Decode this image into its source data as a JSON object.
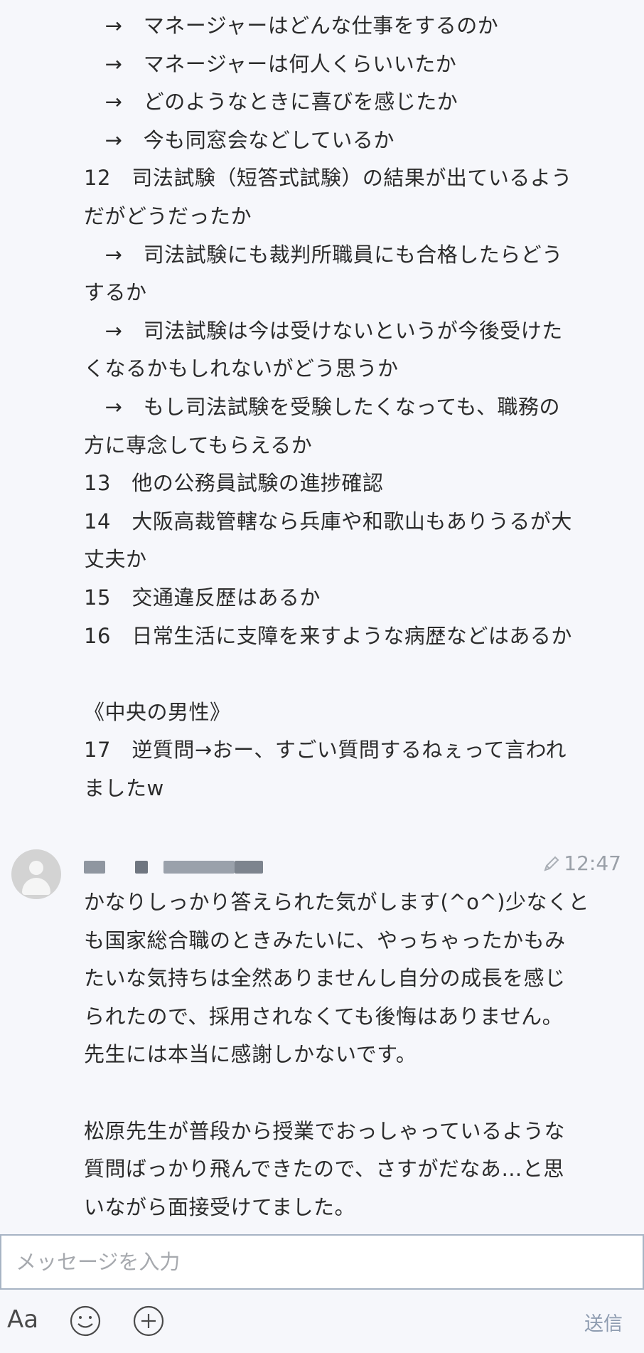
{
  "messages": {
    "previous": {
      "lines": [
        "　→　マネージャーはどんな仕事をするのか",
        "　→　マネージャーは何人くらいいたか",
        "　→　どのようなときに喜びを感じたか",
        "　→　今も同窓会などしているか",
        "12　司法試験（短答式試験）の結果が出ているよう",
        "だがどうだったか",
        "　→　司法試験にも裁判所職員にも合格したらどう",
        "するか",
        "　→　司法試験は今は受けないというが今後受けた",
        "くなるかもしれないがどう思うか",
        "　→　もし司法試験を受験したくなっても、職務の",
        "方に専念してもらえるか",
        "13　他の公務員試験の進捗確認",
        "14　大阪高裁管轄なら兵庫や和歌山もありうるが大",
        "丈夫か",
        "15　交通違反歴はあるか",
        "16　日常生活に支障を来すような病歴などはあるか",
        "",
        "《中央の男性》",
        "17　逆質問→おー、すごい質問するねぇって言われ",
        "ましたw"
      ]
    },
    "current": {
      "time": "12:47",
      "lines": [
        "かなりしっかり答えられた気がします(^o^)少なくと",
        "も国家総合職のときみたいに、やっちゃったかもみ",
        "たいな気持ちは全然ありませんし自分の成長を感じ",
        "られたので、採用されなくても後悔はありません。",
        "先生には本当に感謝しかないです。",
        "",
        "松原先生が普段から授業でおっしゃっているような",
        "質問ばっかり飛んできたので、さすがだなあ…と思",
        "いながら面接受けてました。"
      ]
    }
  },
  "composer": {
    "placeholder": "メッセージを入力",
    "value": ""
  },
  "toolbar": {
    "font_label": "Aa",
    "emoji_icon": "smiley-icon",
    "plus_icon": "plus-circle-icon",
    "send_label": "送信"
  },
  "colors": {
    "background": "#f6f7fb",
    "text": "#2b2b2b",
    "muted": "#9aa0a8",
    "composer_border": "#a7b4c4",
    "send": "#8e9cb0"
  }
}
